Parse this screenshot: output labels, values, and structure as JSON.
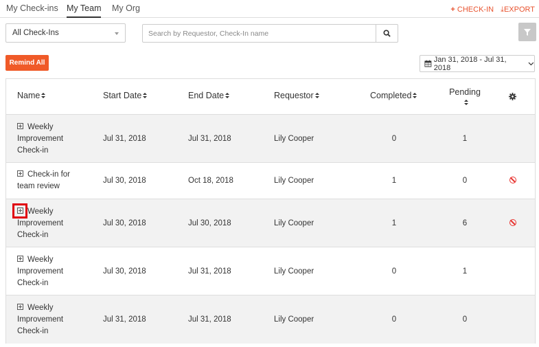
{
  "tabs": [
    {
      "label": "My Check-ins",
      "active": false
    },
    {
      "label": "My Team",
      "active": true
    },
    {
      "label": "My Org",
      "active": false
    }
  ],
  "actions": {
    "checkin": "CHECK-IN",
    "export": "EXPORT",
    "accent": "#e8532f"
  },
  "filter_select": {
    "value": "All Check-Ins"
  },
  "search": {
    "placeholder": "Search by Requestor, Check-In name"
  },
  "remind_all": "Remind All",
  "date_range": "Jan 31, 2018 - Jul 31, 2018",
  "columns": [
    "Name",
    "Start Date",
    "End Date",
    "Requestor",
    "Completed",
    "Pending"
  ],
  "rows": [
    {
      "name": [
        "Weekly",
        "Improvement",
        "Check-in"
      ],
      "start": "Jul 31, 2018",
      "end": "Jul 31, 2018",
      "requestor": "Lily Cooper",
      "completed": "0",
      "pending": "1",
      "cancel": false
    },
    {
      "name": [
        "Check-in for",
        "team review"
      ],
      "start": "Jul 30, 2018",
      "end": "Oct 18, 2018",
      "requestor": "Lily Cooper",
      "completed": "1",
      "pending": "0",
      "cancel": true
    },
    {
      "name": [
        "Weekly",
        "Improvement",
        "Check-in"
      ],
      "start": "Jul 30, 2018",
      "end": "Jul 30, 2018",
      "requestor": "Lily Cooper",
      "completed": "1",
      "pending": "6",
      "cancel": true,
      "highlighted": true
    },
    {
      "name": [
        "Weekly",
        "Improvement",
        "Check-in"
      ],
      "start": "Jul 30, 2018",
      "end": "Jul 31, 2018",
      "requestor": "Lily Cooper",
      "completed": "0",
      "pending": "1",
      "cancel": false
    },
    {
      "name": [
        "Weekly",
        "Improvement",
        "Check-in"
      ],
      "start": "Jul 31, 2018",
      "end": "Jul 31, 2018",
      "requestor": "Lily Cooper",
      "completed": "0",
      "pending": "0",
      "cancel": false
    }
  ]
}
